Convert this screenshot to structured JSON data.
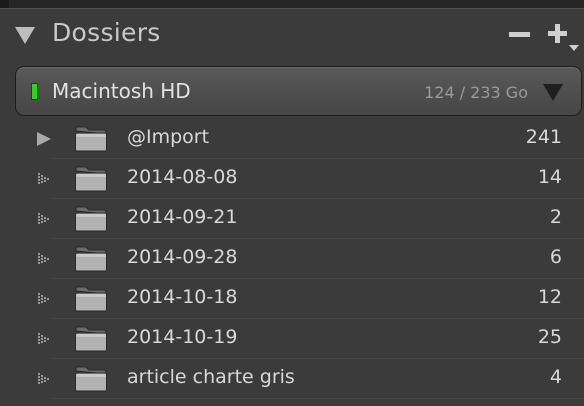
{
  "panel": {
    "title": "Dossiers",
    "collapse_icon": "disclosure-triangle-down-icon",
    "remove_icon": "minus-icon",
    "add_icon": "plus-dropdown-icon"
  },
  "volume": {
    "name": "Macintosh HD",
    "usage": "124 / 233 Go",
    "status_color": "#2bd61d"
  },
  "folders": [
    {
      "name": "@Import",
      "count": "241",
      "expanded": false,
      "has_subfolders": true
    },
    {
      "name": "2014-08-08",
      "count": "14",
      "expanded": false,
      "has_subfolders": false
    },
    {
      "name": "2014-09-21",
      "count": "2",
      "expanded": false,
      "has_subfolders": false
    },
    {
      "name": "2014-09-28",
      "count": "6",
      "expanded": false,
      "has_subfolders": false
    },
    {
      "name": "2014-10-18",
      "count": "12",
      "expanded": false,
      "has_subfolders": false
    },
    {
      "name": "2014-10-19",
      "count": "25",
      "expanded": false,
      "has_subfolders": false
    },
    {
      "name": "article charte gris",
      "count": "4",
      "expanded": false,
      "has_subfolders": false
    }
  ]
}
